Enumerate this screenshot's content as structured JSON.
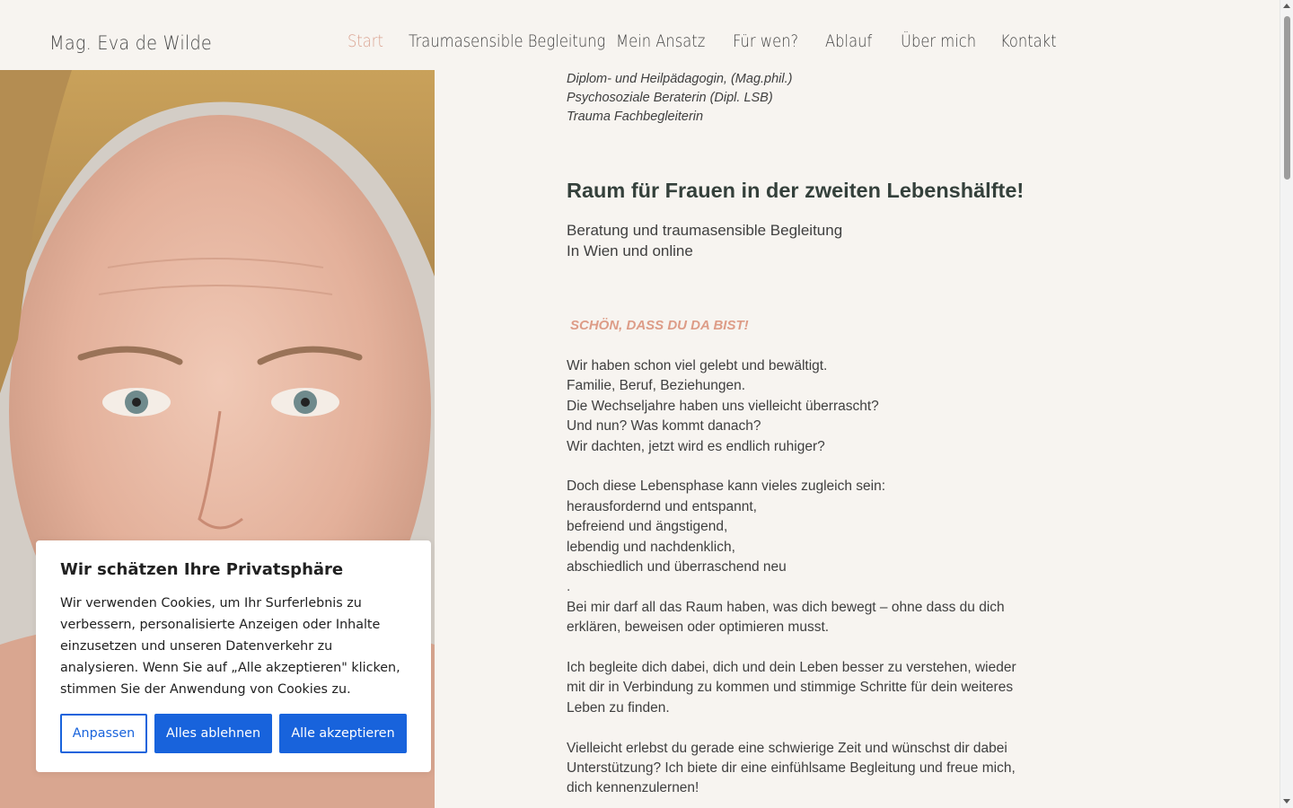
{
  "header": {
    "logo": "Mag. Eva de Wilde",
    "nav": [
      {
        "label": "Start",
        "active": true
      },
      {
        "label": "Traumasensible Begleitung",
        "active": false
      },
      {
        "label": "Mein Ansatz",
        "active": false
      },
      {
        "label": "Für wen?",
        "active": false
      },
      {
        "label": "Ablauf",
        "active": false
      },
      {
        "label": "Über mich",
        "active": false
      },
      {
        "label": "Kontakt",
        "active": false
      }
    ]
  },
  "photo": {
    "icon": "portrait-photo"
  },
  "content": {
    "credentials": [
      "Diplom- und Heilpädagogin, (Mag.phil.)",
      "Psychosoziale Beraterin (Dipl. LSB)",
      "Trauma Fachbegleiterin"
    ],
    "headline": "Raum für Frauen in der zweiten Lebenshälfte!",
    "sub": [
      "Beratung und traumasensible Begleitung",
      "In Wien und online"
    ],
    "welcome": "SCHÖN, DASS DU DA BIST!",
    "paragraph1": [
      "Wir haben schon viel gelebt und bewältigt.",
      "Familie, Beruf, Beziehungen.",
      "Die Wechseljahre haben uns vielleicht überrascht?",
      "Und nun? Was kommt danach?",
      "Wir dachten, jetzt wird es endlich ruhiger?"
    ],
    "paragraph2": [
      "Doch diese Lebensphase kann vieles zugleich sein:",
      "herausfordernd und entspannt,",
      "befreiend und ängstigend,",
      "lebendig und nachdenklich,",
      "abschiedlich und überraschend neu"
    ],
    "dot": ".",
    "paragraph3": [
      "Bei mir darf all das Raum haben, was dich bewegt – ohne dass du dich",
      "erklären, beweisen oder optimieren musst."
    ],
    "paragraph4": [
      "Ich begleite dich dabei, dich und dein Leben besser zu verstehen, wieder",
      "mit dir in Verbindung zu kommen und stimmige Schritte für dein weiteres",
      "Leben zu finden."
    ],
    "paragraph5": [
      "Vielleicht erlebst du gerade eine schwierige Zeit und wünschst dir dabei",
      "Unterstützung? Ich biete dir eine einfühlsame Begleitung und freue mich,",
      "dich kennenzulernen!"
    ]
  },
  "cookie": {
    "title": "Wir schätzen Ihre Privatsphäre",
    "text": "Wir verwenden Cookies, um Ihr Surferlebnis zu verbessern, personalisierte Anzeigen oder Inhalte einzusetzen und unseren Datenverkehr zu analysieren. Wenn Sie auf „Alle akzeptieren\" klicken, stimmen Sie der Anwendung von Cookies zu.",
    "btn_customize": "Anpassen",
    "btn_reject": "Alles ablehnen",
    "btn_accept": "Alle akzeptieren"
  },
  "colors": {
    "background": "#f7f4f0",
    "accent": "#dba492",
    "headline": "#34403b",
    "cookie_blue": "#1863dc"
  }
}
